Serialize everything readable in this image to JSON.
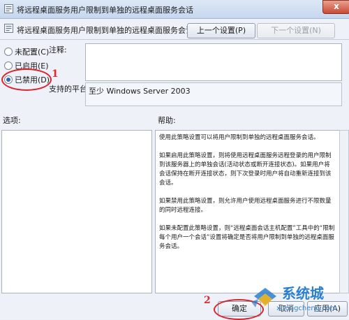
{
  "window": {
    "title": "将远程桌面服务用户限制到单独的远程桌面服务会话",
    "close_glyph": "x"
  },
  "header": {
    "setting_name": "将远程桌面服务用户限制到单独的远程桌面服务会话"
  },
  "nav": {
    "prev_label": "上一个设置(P)",
    "next_label": "下一个设置(N)"
  },
  "state": {
    "options": [
      {
        "label": "未配置(C)",
        "selected": false
      },
      {
        "label": "已启用(E)",
        "selected": false
      },
      {
        "label": "已禁用(D)",
        "selected": true
      }
    ]
  },
  "comment": {
    "label": "注释:",
    "value": ""
  },
  "platform": {
    "label": "支持的平台:",
    "value": "至少 Windows Server 2003"
  },
  "panels": {
    "options_label": "选项:",
    "help_label": "帮助:"
  },
  "help_paragraphs": [
    "使用此策略设置可以将用户限制到单独的远程桌面服务会话。",
    "如果启用此策略设置，则将使用远程桌面服务远程登录的用户限制到该服务器上的单独会话(活动状态或断开连接状态)。如果用户将会话保持在断开连接状态，则下次登录时用户将自动重新连接到该会话。",
    "如果禁用此策略设置，则允许用户使用远程桌面服务进行不限数量的同时远程连接。",
    "如果未配置此策略设置，则“远程桌面会话主机配置”工具中的“限制每个用户一个会话”设置将确定是否将用户限制到单独的远程桌面服务会话。"
  ],
  "footer": {
    "ok_label": "确定",
    "cancel_label": "取消",
    "apply_label": "应用(A)"
  },
  "annotations": {
    "step1": "1",
    "step2": "2"
  },
  "watermark": {
    "text": "系统城",
    "url": "xitongcheng.com"
  },
  "colors": {
    "accent": "#2b67b8",
    "annotation": "#d9232e",
    "watermark": "#2a7fd1"
  }
}
